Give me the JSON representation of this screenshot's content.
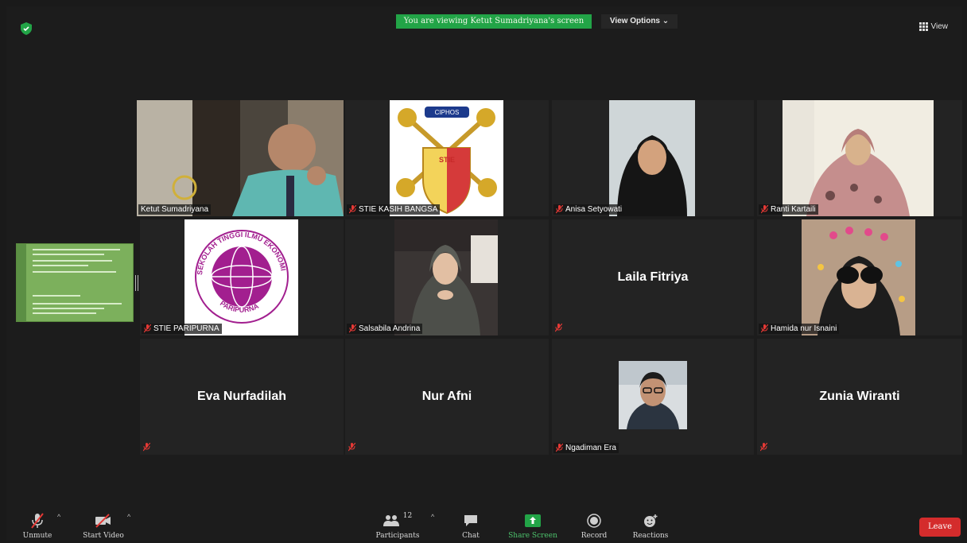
{
  "header": {
    "banner": "You are viewing Ketut Sumadriyana's screen",
    "view_options": "View Options",
    "view": "View"
  },
  "tiles": [
    {
      "name": "Ketut Sumadriyana",
      "type": "video"
    },
    {
      "name": "STIE KASIH BANGSA",
      "type": "logo"
    },
    {
      "name": "Anisa Setyowati",
      "type": "video"
    },
    {
      "name": "Ranti Kartaili",
      "type": "video"
    },
    {
      "name": "STIE PARIPURNA",
      "type": "logo"
    },
    {
      "name": "Salsabila Andrina",
      "type": "video"
    },
    {
      "name": "Laila Fitriya",
      "type": "name"
    },
    {
      "name": "Hamida nur Isnaini",
      "type": "video"
    },
    {
      "name": "Eva Nurfadilah",
      "type": "name"
    },
    {
      "name": "Nur Afni",
      "type": "name"
    },
    {
      "name": "Ngadiman Era",
      "type": "video"
    },
    {
      "name": "Zunia Wiranti",
      "type": "name"
    }
  ],
  "logos": {
    "kasih_bangsa": {
      "ribbon": "CIPHOS",
      "text": "KASIH BANGSA",
      "stie": "STIE"
    },
    "paripurna": {
      "top": "SEKOLAH TINGGI ILMU EKONOMI",
      "bottom": "PARIPURNA"
    }
  },
  "toolbar": {
    "unmute": "Unmute",
    "start_video": "Start Video",
    "participants": "Participants",
    "participants_count": "12",
    "chat": "Chat",
    "share_screen": "Share Screen",
    "record": "Record",
    "reactions": "Reactions",
    "leave": "Leave"
  },
  "colors": {
    "banner": "#22a447",
    "active_speaker": "#c6dd53",
    "leave": "#d42c2c",
    "mute": "#e53935"
  }
}
